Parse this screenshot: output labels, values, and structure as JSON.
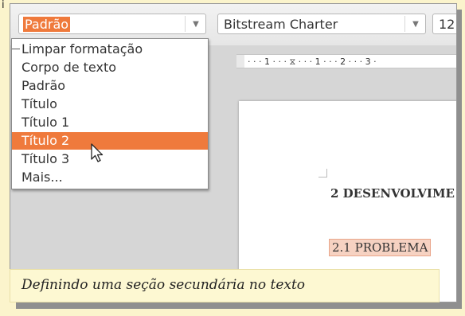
{
  "top_strip": {
    "leading_char": "i"
  },
  "toolbar": {
    "style_combo": {
      "value": "Padrão",
      "arrow_icon": "chevron-down-icon"
    },
    "font_combo": {
      "value": "Bitstream Charter",
      "arrow_icon": "chevron-down-icon"
    },
    "size_combo": {
      "value": "12"
    }
  },
  "ruler": {
    "ticks": "· · · 1 · · · ⧖ · · · 1 · · · 2 · · · 3 ·"
  },
  "dropdown": {
    "items": [
      {
        "label": "Limpar formatação"
      },
      {
        "label": "Corpo de texto"
      },
      {
        "label": "Padrão"
      },
      {
        "label": "Título"
      },
      {
        "label": "Título 1"
      },
      {
        "label": "Título 2"
      },
      {
        "label": "Título 3"
      },
      {
        "label": "Mais..."
      }
    ],
    "active_index": 5
  },
  "document": {
    "heading1": "2 DESENVOLVIME",
    "heading2": "2.1 PROBLEMA"
  },
  "caption": {
    "text": "Definindo uma seção secundária no texto"
  },
  "colors": {
    "accent": "#ef7a3c",
    "background": "#fbf4cc",
    "caption_bg": "#fdf8d2"
  }
}
